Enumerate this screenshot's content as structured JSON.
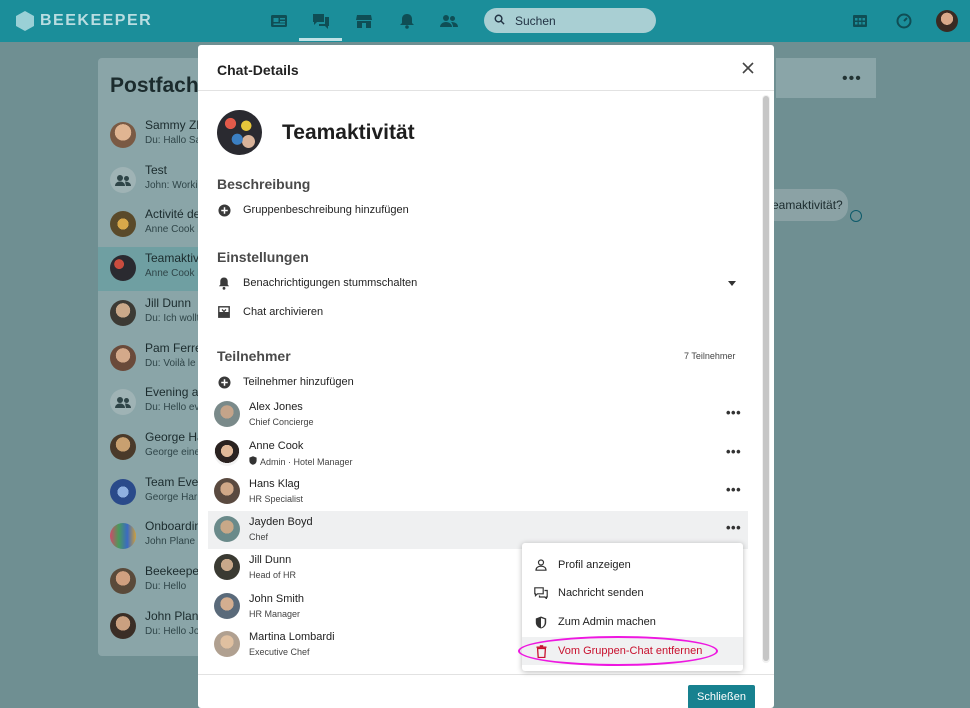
{
  "app": {
    "logo_text": "BEEKEEPER",
    "brand_color": "#1b8e9a",
    "accent_color": "#17818f"
  },
  "topbar": {
    "nav_icons": [
      "news-icon",
      "chat-icon",
      "store-icon",
      "bell-icon",
      "people-icon"
    ],
    "search": {
      "placeholder": "Suchen"
    },
    "right_icons": [
      "apps-icon",
      "dashboard-icon",
      "user-avatar"
    ]
  },
  "inbox": {
    "title": "Postfach",
    "items": [
      {
        "name": "Sammy Zh",
        "snippet": "Du: Hallo Sa"
      },
      {
        "name": "Test",
        "snippet": "John: Worki"
      },
      {
        "name": "Activité de",
        "snippet": "Anne Cook h"
      },
      {
        "name": "Teamaktivi",
        "snippet": "Anne Cook h"
      },
      {
        "name": "Jill Dunn",
        "snippet": "Du: Ich wollt"
      },
      {
        "name": "Pam Ferre",
        "snippet": "Du: Voilà le p"
      },
      {
        "name": "Evening ac",
        "snippet": "Du: Hello ev"
      },
      {
        "name": "George Ha",
        "snippet": "George eine"
      },
      {
        "name": "Team Even",
        "snippet": "George Harr"
      },
      {
        "name": "Onboardin",
        "snippet": "John Plane h"
      },
      {
        "name": "Beekeeper",
        "snippet": "Du: Hello"
      },
      {
        "name": "John Plane",
        "snippet": "Du: Hello Jo"
      }
    ]
  },
  "background_chat": {
    "bubble_text": "eamaktivität?"
  },
  "modal": {
    "title": "Chat-Details",
    "group_name": "Teamaktivität",
    "description": {
      "heading": "Beschreibung",
      "add_label": "Gruppenbeschreibung hinzufügen"
    },
    "settings": {
      "heading": "Einstellungen",
      "mute_label": "Benachrichtigungen stummschalten",
      "archive_label": "Chat archivieren"
    },
    "participants": {
      "heading": "Teilnehmer",
      "count_label": "7 Teilnehmer",
      "add_label": "Teilnehmer hinzufügen",
      "members": [
        {
          "name": "Alex Jones",
          "role": "Chief Concierge"
        },
        {
          "name": "Anne Cook",
          "role": "Admin · Hotel Manager"
        },
        {
          "name": "Hans Klag",
          "role": "HR Specialist"
        },
        {
          "name": "Jayden Boyd",
          "role": "Chef"
        },
        {
          "name": "Jill Dunn",
          "role": "Head of HR"
        },
        {
          "name": "John Smith",
          "role": "HR Manager"
        },
        {
          "name": "Martina Lombardi",
          "role": "Executive Chef"
        }
      ]
    },
    "close_button": "Schließen"
  },
  "context_menu": {
    "items": [
      {
        "label": "Profil anzeigen",
        "icon": "person-icon"
      },
      {
        "label": "Nachricht senden",
        "icon": "message-icon"
      },
      {
        "label": "Zum Admin machen",
        "icon": "shield-icon"
      },
      {
        "label": "Vom Gruppen-Chat entfernen",
        "icon": "trash-icon"
      }
    ]
  }
}
